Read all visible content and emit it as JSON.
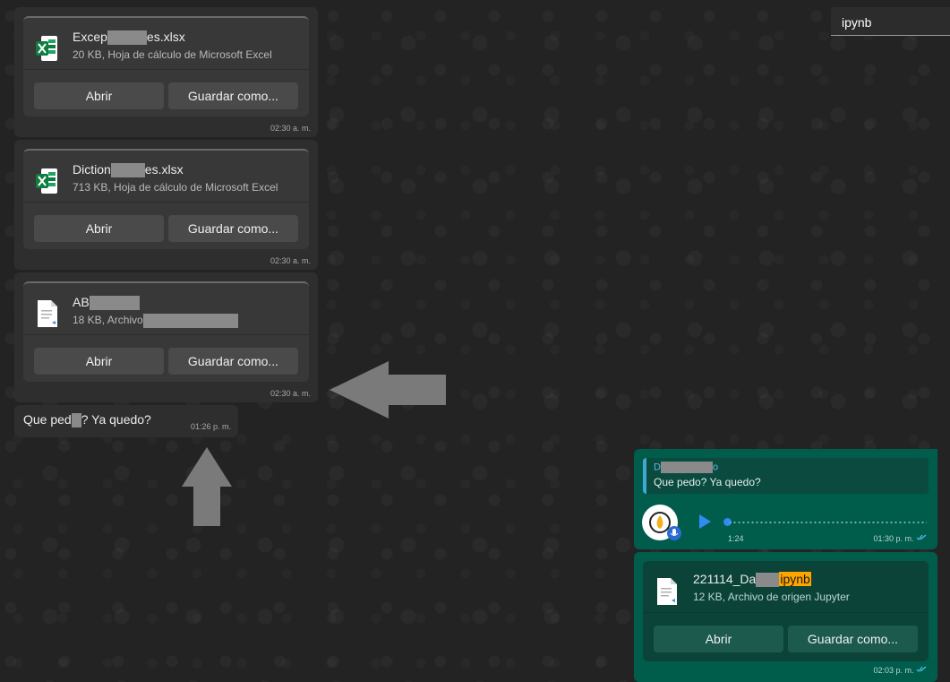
{
  "search": {
    "value": "ipynb"
  },
  "messages_in": [
    {
      "file_name_a": "Excep",
      "file_name_b": "es.xlsx",
      "file_meta": "20 KB, Hoja de cálculo de Microsoft Excel",
      "icon": "excel-icon",
      "open_label": "Abrir",
      "save_label": "Guardar como...",
      "time": "02:30 a. m."
    },
    {
      "file_name_a": "Diction",
      "file_name_b": "es.xlsx",
      "file_meta": "713 KB, Hoja de cálculo de Microsoft Excel",
      "icon": "excel-icon",
      "open_label": "Abrir",
      "save_label": "Guardar como...",
      "time": "02:30 a. m."
    },
    {
      "file_name_a": "AB",
      "file_meta": "18 KB, Archivo",
      "icon": "document-icon",
      "open_label": "Abrir",
      "save_label": "Guardar como...",
      "time": "02:30 a. m."
    }
  ],
  "text_message": {
    "text_a": "Que ped",
    "text_b": "? Ya quedo?",
    "time": "01:26 p. m."
  },
  "voice_message": {
    "quote_author": "D",
    "quote_author_tail": "o",
    "quote_text": "Que pedo? Ya quedo?",
    "duration": "1:24",
    "time": "01:30 p. m.",
    "status": "read"
  },
  "file_message_out": {
    "file_name": "221114_Da",
    "file_name_highlight": "ipynb",
    "file_meta": "12 KB, Archivo de origen Jupyter",
    "open_label": "Abrir",
    "save_label": "Guardar como...",
    "time": "02:03 p. m.",
    "status": "read"
  },
  "colors": {
    "outgoing_bubble": "#005c4b",
    "incoming_bubble": "#2e2e2e",
    "search_highlight": "#ffa500",
    "read_ticks": "#53bdeb",
    "annotation_arrow": "#7a7a7a"
  }
}
